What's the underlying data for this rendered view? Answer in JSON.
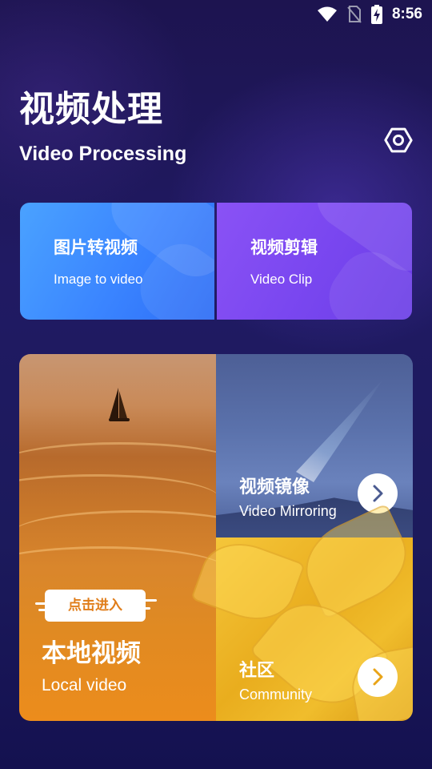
{
  "status_bar": {
    "time": "8:56",
    "icons": [
      "wifi-icon",
      "no-sim-icon",
      "battery-charging-icon"
    ]
  },
  "header": {
    "title_cn": "视频处理",
    "title_en": "Video Processing",
    "settings_icon": "settings-hexagon-icon"
  },
  "top_cards": [
    {
      "title_cn": "图片转视频",
      "title_en": "Image to video",
      "color": "#3a84ff"
    },
    {
      "title_cn": "视频剪辑",
      "title_en": "Video Clip",
      "color": "#7a47f0"
    }
  ],
  "local_video": {
    "badge": "点击进入",
    "title_cn": "本地视频",
    "title_en": "Local video",
    "accent": "#e07d1a"
  },
  "mirroring": {
    "title_cn": "视频镜像",
    "title_en": "Video Mirroring",
    "arrow_icon": "chevron-right-icon"
  },
  "community": {
    "title_cn": "社区",
    "title_en": "Community",
    "arrow_icon": "chevron-right-icon"
  }
}
